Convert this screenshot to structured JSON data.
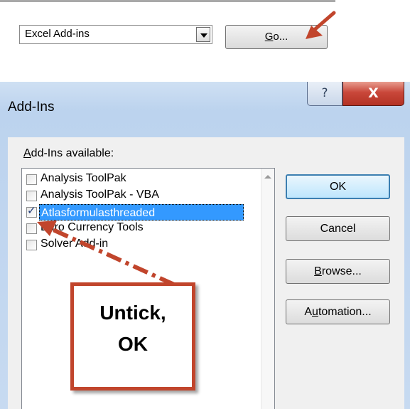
{
  "top": {
    "manage_value": "Excel Add-ins",
    "go_label_pre": "",
    "go_label_ul": "G",
    "go_label_post": "o..."
  },
  "dialog": {
    "title": "Add-Ins",
    "help_glyph": "?",
    "close_glyph": "X",
    "available_label_ul": "A",
    "available_label_rest": "dd-Ins available:",
    "items": [
      {
        "label": "Analysis ToolPak",
        "checked": false
      },
      {
        "label": "Analysis ToolPak - VBA",
        "checked": false
      },
      {
        "label": "Atlasformulasthreaded",
        "checked": true
      },
      {
        "label": "Euro Currency Tools",
        "checked": false
      },
      {
        "label": "Solver Add-in",
        "checked": false
      }
    ],
    "buttons": {
      "ok": "OK",
      "cancel": "Cancel",
      "browse_ul": "B",
      "browse_rest": "rowse...",
      "automation_pre": "A",
      "automation_ul": "u",
      "automation_rest": "tomation..."
    },
    "check_glyph": "✓"
  },
  "annotation": {
    "line1": "Untick,",
    "line2": "OK",
    "color": "#c1452c"
  }
}
